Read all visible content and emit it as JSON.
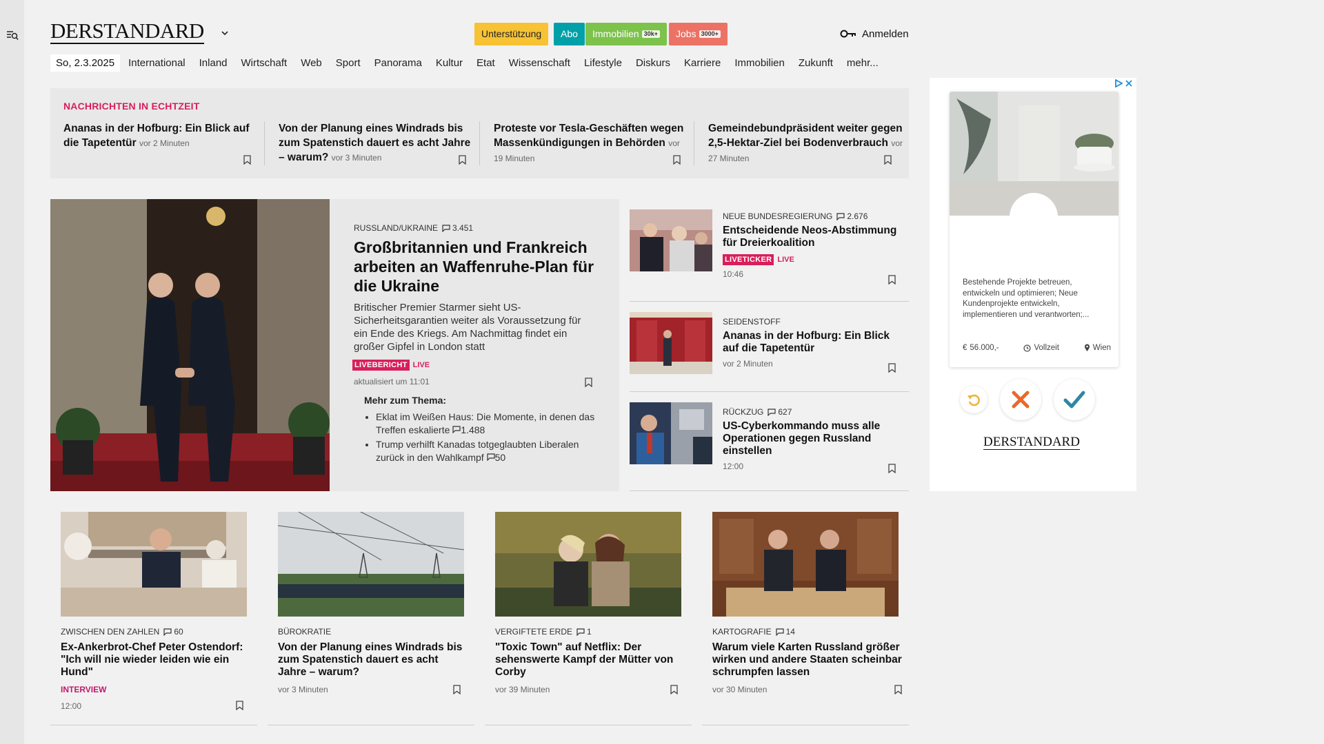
{
  "header": {
    "logo": "DERSTANDARD",
    "buttons": {
      "support": "Unterstützung",
      "abo": "Abo",
      "immobilien": "Immobilien",
      "immobilien_tag": "30k+",
      "jobs": "Jobs",
      "jobs_tag": "3000+"
    },
    "login": "Anmelden"
  },
  "nav": {
    "date": "So, 2.3.2025",
    "items": [
      "International",
      "Inland",
      "Wirtschaft",
      "Web",
      "Sport",
      "Panorama",
      "Kultur",
      "Etat",
      "Wissenschaft",
      "Lifestyle",
      "Diskurs",
      "Karriere",
      "Immobilien",
      "Zukunft",
      "mehr..."
    ]
  },
  "realtime": {
    "heading": "NACHRICHTEN IN ECHTZEIT",
    "items": [
      {
        "title": "Ananas in der Hofburg: Ein Blick auf die Tapetentür",
        "time": "vor 2 Minuten"
      },
      {
        "title": "Von der Planung eines Windrads bis zum Spatenstich dauert es acht Jahre – warum?",
        "time": "vor 3 Minuten"
      },
      {
        "title": "Proteste vor Tesla-Geschäften wegen Massenkündigungen in Behörden",
        "time": "vor 19 Minuten"
      },
      {
        "title": "Gemeindebundpräsident weiter gegen 2,5-Hektar-Ziel bei Bodenverbrauch",
        "time": "vor 27 Minuten"
      }
    ]
  },
  "lead": {
    "kicker": "RUSSLAND/UKRAINE",
    "comments": "3.451",
    "title": "Großbritannien und Frankreich arbeiten an Waffenruhe-Plan für die Ukraine",
    "teaser": "Britischer Premier Starmer sieht US-Sicherheitsgarantien weiter als Voraussetzung für ein Ende des Kriegs. Am Nachmittag findet ein großer Gipfel in London statt",
    "badge": "LIVEBERICHT",
    "live": "LIVE",
    "updated": "aktualisiert um 11:01",
    "more_title": "Mehr zum Thema:",
    "more": [
      {
        "text": "Eklat im Weißen Haus: Die Momente, in denen das Treffen eskalierte",
        "comments": "1.488"
      },
      {
        "text": "Trump verhilft Kanadas totgeglaubten Liberalen zurück in den Wahlkampf",
        "comments": "50"
      }
    ]
  },
  "side": [
    {
      "kicker": "NEUE BUNDESREGIERUNG",
      "comments": "2.676",
      "title": "Entscheidende Neos-Abstimmung für Dreierkoalition",
      "badge": "LIVETICKER",
      "live": "LIVE",
      "meta": "10:46"
    },
    {
      "kicker": "SEIDENSTOFF",
      "comments": "",
      "title": "Ananas in der Hofburg: Ein Blick auf die Tapetentür",
      "meta": "vor 2 Minuten"
    },
    {
      "kicker": "RÜCKZUG",
      "comments": "627",
      "title": "US-Cyberkommando muss alle Operationen gegen Russland einstellen",
      "meta": "12:00"
    }
  ],
  "cards": [
    {
      "kicker": "ZWISCHEN DEN ZAHLEN",
      "comments": "60",
      "title": "Ex-Ankerbrot-Chef Peter Ostendorf: \"Ich will nie wieder leiden wie ein Hund\"",
      "tag": "INTERVIEW",
      "meta": "12:00"
    },
    {
      "kicker": "BÜROKRATIE",
      "comments": "",
      "title": "Von der Planung eines Windrads bis zum Spatenstich dauert es acht Jahre – warum?",
      "meta": "vor 3 Minuten"
    },
    {
      "kicker": "VERGIFTETE ERDE",
      "comments": "1",
      "title": "\"Toxic Town\" auf Netflix: Der sehenswerte Kampf der Mütter von Corby",
      "meta": "vor 39 Minuten"
    },
    {
      "kicker": "KARTOGRAFIE",
      "comments": "14",
      "title": "Warum viele Karten Russland größer wirken und andere Staaten scheinbar schrumpfen lassen",
      "meta": "vor 30 Minuten"
    }
  ],
  "ad": {
    "description": "Bestehende Projekte betreuen, entwickeln und optimieren; Neue Kundenprojekte entwickeln, implementieren und verantworten;...",
    "salary": "56.000,-",
    "type": "Vollzeit",
    "location": "Wien",
    "logo": "DERSTANDARD"
  },
  "colors": {
    "accent": "#d81e5b",
    "support": "#f7c233",
    "abo": "#00a0a9",
    "immobilien": "#7dc24b",
    "jobs": "#ec7265"
  }
}
